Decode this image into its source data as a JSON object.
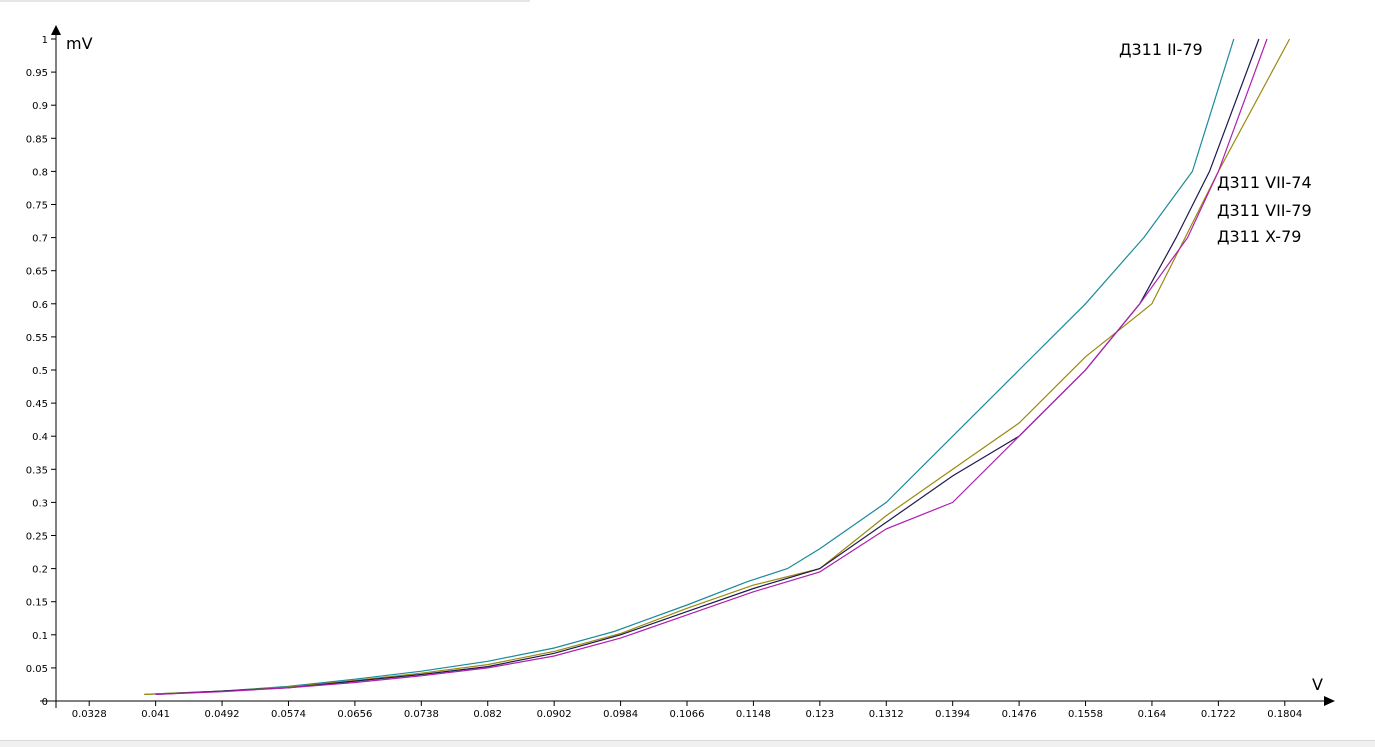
{
  "chart_data": {
    "type": "line",
    "xlabel": "V",
    "ylabel": "mV",
    "xlim": [
      0.0287,
      0.1845
    ],
    "ylim": [
      0,
      1
    ],
    "x_ticks": [
      "0.0328",
      "0.041",
      "0.0492",
      "0.0574",
      "0.0656",
      "0.0738",
      "0.082",
      "0.0902",
      "0.0984",
      "0.1066",
      "0.1148",
      "0.123",
      "0.1312",
      "0.1394",
      "0.1476",
      "0.1558",
      "0.164",
      "0.1722",
      "0.1804"
    ],
    "y_ticks": [
      "0",
      "0.05",
      "0.1",
      "0.15",
      "0.2",
      "0.25",
      "0.3",
      "0.35",
      "0.4",
      "0.45",
      "0.5",
      "0.55",
      "0.6",
      "0.65",
      "0.7",
      "0.75",
      "0.8",
      "0.85",
      "0.9",
      "0.95",
      "1"
    ],
    "grid": false,
    "series": [
      {
        "name": "Д311 II-79",
        "color": "#1a8a9a",
        "x": [
          0.0396,
          0.0492,
          0.0574,
          0.0656,
          0.0738,
          0.082,
          0.0902,
          0.0976,
          0.1066,
          0.114,
          0.119,
          0.123,
          0.1312,
          0.1394,
          0.1476,
          0.1558,
          0.163,
          0.169,
          0.1741
        ],
        "y": [
          0.01,
          0.015,
          0.022,
          0.033,
          0.045,
          0.06,
          0.08,
          0.105,
          0.145,
          0.18,
          0.2,
          0.23,
          0.3,
          0.4,
          0.5,
          0.6,
          0.7,
          0.8,
          1.0
        ]
      },
      {
        "name": "Д311 VII-74",
        "color": "#9a8a10",
        "x": [
          0.0396,
          0.0492,
          0.0574,
          0.0656,
          0.0738,
          0.082,
          0.0902,
          0.0984,
          0.1066,
          0.1148,
          0.123,
          0.1312,
          0.1394,
          0.1476,
          0.1558,
          0.164,
          0.1722,
          0.181
        ],
        "y": [
          0.01,
          0.015,
          0.021,
          0.031,
          0.042,
          0.055,
          0.075,
          0.102,
          0.14,
          0.175,
          0.2,
          0.28,
          0.35,
          0.42,
          0.52,
          0.6,
          0.8,
          1.0
        ]
      },
      {
        "name": "Д311 VII-79",
        "color": "#1a1a50",
        "x": [
          0.041,
          0.0492,
          0.0574,
          0.0656,
          0.0738,
          0.082,
          0.0902,
          0.0984,
          0.1066,
          0.1148,
          0.123,
          0.1312,
          0.1394,
          0.1476,
          0.1558,
          0.1625,
          0.167,
          0.1711,
          0.1772
        ],
        "y": [
          0.01,
          0.015,
          0.02,
          0.03,
          0.04,
          0.052,
          0.072,
          0.1,
          0.135,
          0.17,
          0.2,
          0.27,
          0.34,
          0.4,
          0.5,
          0.6,
          0.7,
          0.8,
          1.0
        ]
      },
      {
        "name": "Д311 X-79",
        "color": "#b020b0",
        "x": [
          0.041,
          0.0492,
          0.0574,
          0.0656,
          0.0738,
          0.082,
          0.0902,
          0.0984,
          0.1066,
          0.1148,
          0.123,
          0.1312,
          0.1394,
          0.1476,
          0.1558,
          0.1625,
          0.1684,
          0.1722,
          0.1782
        ],
        "y": [
          0.01,
          0.014,
          0.02,
          0.028,
          0.038,
          0.05,
          0.068,
          0.095,
          0.13,
          0.165,
          0.195,
          0.26,
          0.3,
          0.4,
          0.5,
          0.6,
          0.7,
          0.8,
          1.0
        ]
      }
    ]
  }
}
